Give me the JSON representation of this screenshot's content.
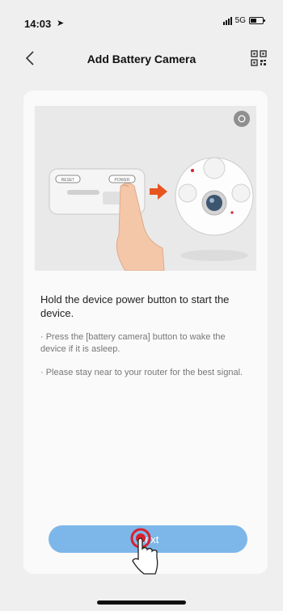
{
  "status_bar": {
    "time": "14:03",
    "location_icon": "location-arrow-icon",
    "network": "5G",
    "battery_icon": "battery-icon"
  },
  "nav": {
    "title": "Add Battery Camera",
    "back_icon": "chevron-left-icon",
    "qr_icon": "qr-code-icon"
  },
  "illustration": {
    "labels": {
      "reset": "RESET",
      "power": "POWER"
    },
    "help_icon": "help-icon"
  },
  "instructions": {
    "main": "Hold the device power button to start the device.",
    "tips": [
      "· Press the [battery camera] button to wake the device if it is asleep.",
      "· Please stay near to your router for the best signal."
    ]
  },
  "action_button": {
    "label": "Next"
  },
  "colors": {
    "accent": "#7db7e9",
    "arrow": "#e8541f",
    "tap": "#d9202e"
  }
}
